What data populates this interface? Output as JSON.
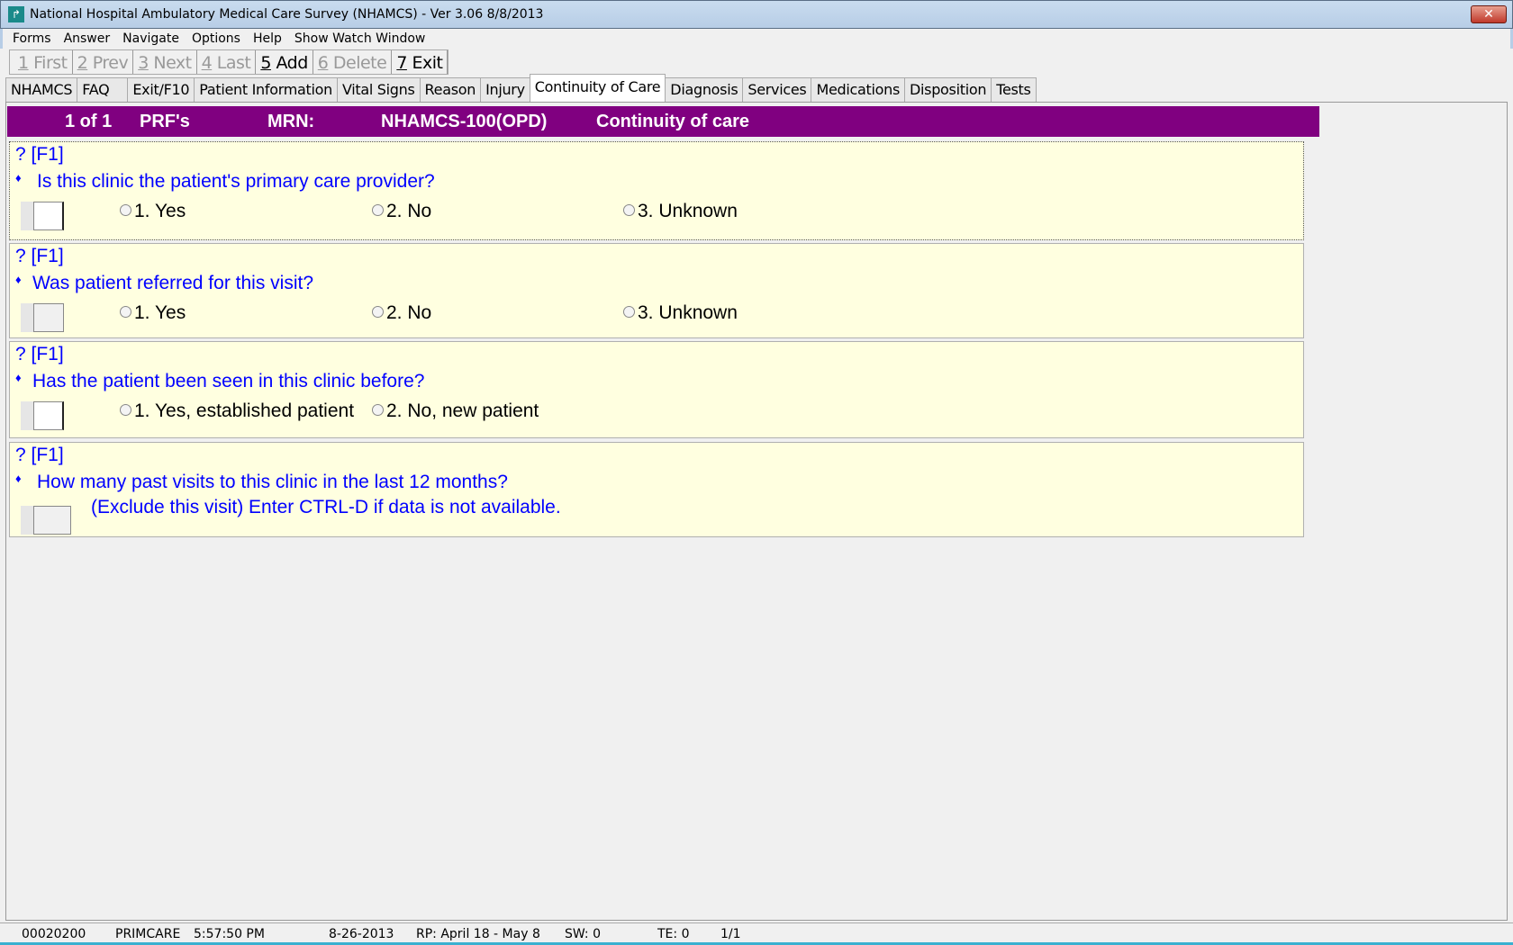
{
  "window": {
    "title": "National Hospital Ambulatory Medical Care Survey (NHAMCS) - Ver 3.06 8/8/2013",
    "close": "✕"
  },
  "menu": [
    "Forms",
    "Answer",
    "Navigate",
    "Options",
    "Help",
    "Show Watch Window"
  ],
  "toolbar": [
    {
      "key": "1",
      "label": " First",
      "enabled": false
    },
    {
      "key": "2",
      "label": " Prev",
      "enabled": false
    },
    {
      "key": "3",
      "label": " Next",
      "enabled": false
    },
    {
      "key": "4",
      "label": " Last",
      "enabled": false
    },
    {
      "key": "5",
      "label": " Add",
      "enabled": true
    },
    {
      "key": "6",
      "label": " Delete",
      "enabled": false
    },
    {
      "key": "7",
      "label": " Exit",
      "enabled": true
    }
  ],
  "tabs": [
    "NHAMCS",
    "FAQ",
    "Exit/F10",
    "Patient Information",
    "Vital Signs",
    "Reason",
    "Injury",
    "Continuity of Care",
    "Diagnosis",
    "Services",
    "Medications",
    "Disposition",
    "Tests"
  ],
  "active_tab": "Continuity of Care",
  "header": {
    "record": "1 of 1",
    "prf": "PRF's",
    "mrn_label": "MRN:",
    "mrn": "NHAMCS-100(OPD)",
    "section": "Continuity of care"
  },
  "questions": [
    {
      "help": "? [F1]",
      "text": "Is this clinic the patient's primary care provider?",
      "options": [
        "1. Yes",
        "2. No",
        "3. Unknown"
      ]
    },
    {
      "help": "? [F1]",
      "text": "Was patient referred for this visit?",
      "options": [
        "1. Yes",
        "2. No",
        "3. Unknown"
      ]
    },
    {
      "help": "? [F1]",
      "text": "Has the patient been seen in this clinic before?",
      "options": [
        "1. Yes, established patient",
        "2. No, new patient"
      ]
    },
    {
      "help": "? [F1]",
      "text": "How many past visits to this clinic in the last 12 months?",
      "subtext": "(Exclude this visit) Enter CTRL-D if data is not available."
    }
  ],
  "diamond": "♦",
  "status": {
    "id": "00020200",
    "mode": "PRIMCARE",
    "time": "5:57:50 PM",
    "date": "8-26-2013",
    "rp": "RP: April 18  -  May 8",
    "sw": "SW: 0",
    "te": "TE: 0",
    "page": "1/1"
  }
}
